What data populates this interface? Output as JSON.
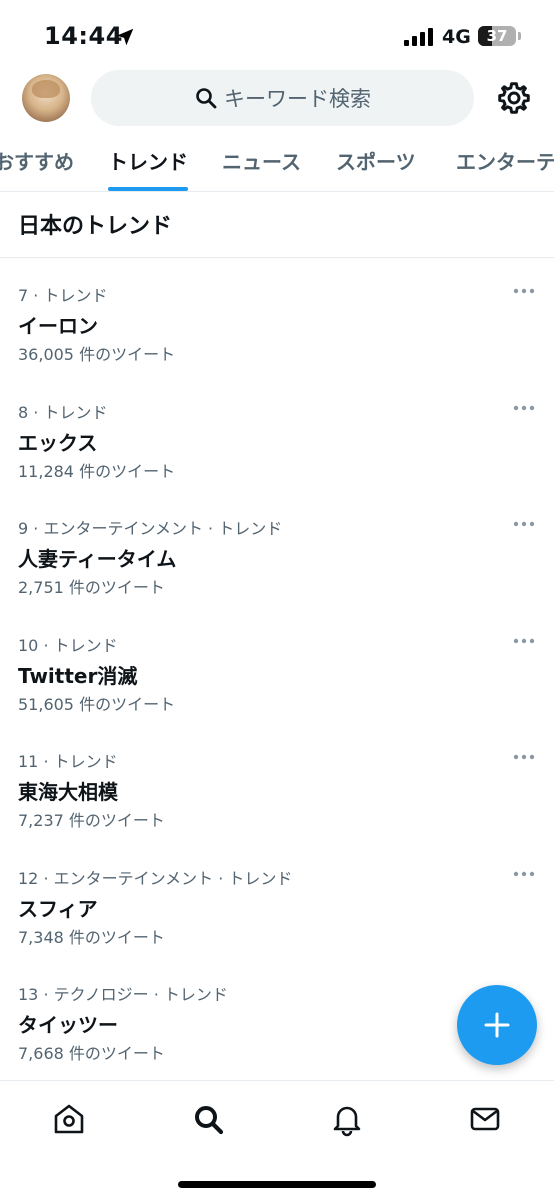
{
  "status_bar": {
    "time": "14:44",
    "network": "4G",
    "battery": "37",
    "battery_level": 0.37,
    "icons": [
      "location-arrow-icon",
      "signal-bars-icon",
      "battery-icon"
    ]
  },
  "header": {
    "search_placeholder": "キーワード検索",
    "icons": [
      "avatar",
      "search-icon",
      "gear-icon"
    ]
  },
  "tabs": [
    {
      "label": "おすすめ",
      "active": false
    },
    {
      "label": "トレンド",
      "active": true
    },
    {
      "label": "ニュース",
      "active": false
    },
    {
      "label": "スポーツ",
      "active": false
    },
    {
      "label": "エンターテ",
      "active": false
    }
  ],
  "section_title": "日本のトレンド",
  "trends": [
    {
      "meta": "7 · トレンド",
      "name": "イーロン",
      "count": "36,005 件のツイート"
    },
    {
      "meta": "8 · トレンド",
      "name": "エックス",
      "count": "11,284 件のツイート"
    },
    {
      "meta": "9 · エンターテインメント · トレンド",
      "name": "人妻ティータイム",
      "count": "2,751 件のツイート"
    },
    {
      "meta": "10 · トレンド",
      "name": "Twitter消滅",
      "count": "51,605 件のツイート"
    },
    {
      "meta": "11 · トレンド",
      "name": "東海大相模",
      "count": "7,237 件のツイート"
    },
    {
      "meta": "12 · エンターテインメント · トレンド",
      "name": "スフィア",
      "count": "7,348 件のツイート"
    },
    {
      "meta": "13 · テクノロジー · トレンド",
      "name": "タイッツー",
      "count": "7,668 件のツイート"
    }
  ],
  "fab_icon": "plus-icon",
  "bottom_nav": [
    "home-icon",
    "search-icon",
    "bell-icon",
    "mail-icon"
  ],
  "colors": {
    "accent": "#1d9bf0",
    "text": "#0f1419",
    "secondary": "#536471"
  }
}
